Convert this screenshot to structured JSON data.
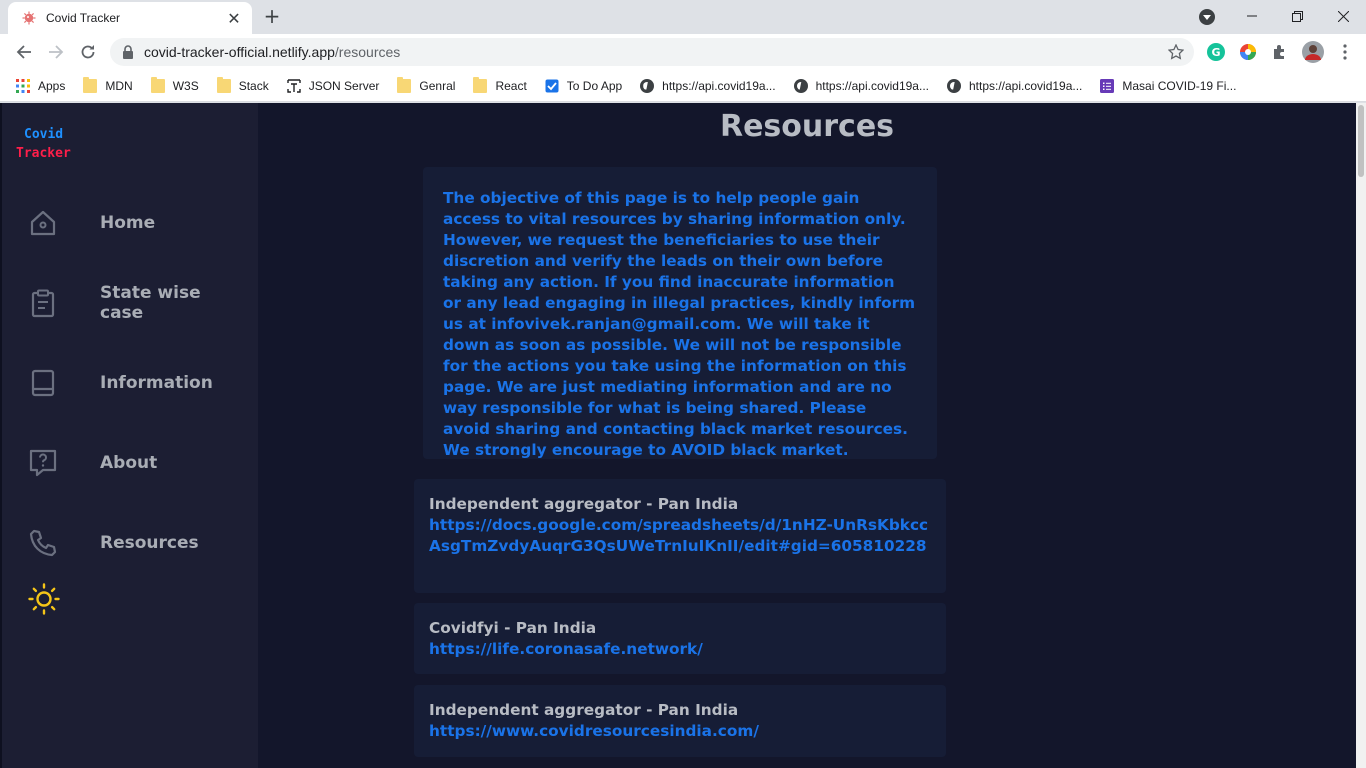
{
  "browser": {
    "tab_title": "Covid Tracker",
    "url_host": "covid-tracker-official.netlify.app",
    "url_path": "/resources",
    "bookmarks": [
      {
        "label": "Apps",
        "icon": "apps-grid-icon"
      },
      {
        "label": "MDN",
        "icon": "folder-icon"
      },
      {
        "label": "W3S",
        "icon": "folder-icon"
      },
      {
        "label": "Stack",
        "icon": "folder-icon"
      },
      {
        "label": "JSON Server",
        "icon": "json-server-icon"
      },
      {
        "label": "Genral",
        "icon": "folder-icon"
      },
      {
        "label": "React",
        "icon": "folder-icon"
      },
      {
        "label": "To Do App",
        "icon": "checkbox-icon"
      },
      {
        "label": "https://api.covid19a...",
        "icon": "globe-icon"
      },
      {
        "label": "https://api.covid19a...",
        "icon": "globe-icon"
      },
      {
        "label": "https://api.covid19a...",
        "icon": "globe-icon"
      },
      {
        "label": "Masai COVID-19 Fi...",
        "icon": "forms-icon"
      }
    ]
  },
  "sidebar": {
    "logo_line1": "Covid",
    "logo_line2": "Tracker",
    "items": [
      {
        "label": "Home",
        "icon": "home-icon"
      },
      {
        "label": "State wise case",
        "icon": "clipboard-icon"
      },
      {
        "label": "Information",
        "icon": "book-icon"
      },
      {
        "label": "About",
        "icon": "help-icon"
      },
      {
        "label": "Resources",
        "icon": "phone-icon"
      }
    ],
    "theme_toggle_icon": "sun-icon"
  },
  "main": {
    "title": "Resources",
    "disclaimer": "The objective of this page is to help people gain access to vital resources by sharing information only. However, we request the beneficiaries to use their discretion and verify the leads on their own before taking any action. If you find inaccurate information or any lead engaging in illegal practices, kindly inform us at infovivek.ranjan@gmail.com. We will take it down as soon as possible. We will not be responsible for the actions you take using the information on this page. We are just mediating information and are no way responsible for what is being shared. Please avoid sharing and contacting black market resources. We strongly encourage to AVOID black market.",
    "resources": [
      {
        "title": "Independent aggregator - Pan India",
        "link": "https://docs.google.com/spreadsheets/d/1nHZ-UnRsKbkccAsgTmZvdyAuqrG3QsUWeTrnIuIKnII/edit#gid=605810228"
      },
      {
        "title": "Covidfyi - Pan India",
        "link": "https://life.coronasafe.network/"
      },
      {
        "title": "Independent aggregator - Pan India",
        "link": "https://www.covidresourcesindia.com/"
      }
    ]
  },
  "colors": {
    "page_bg": "#13162b",
    "sidebar_bg": "#1c1e33",
    "card_bg": "#161d36",
    "accent_blue": "#1a73e8",
    "logo_blue": "#1e90ff",
    "logo_red": "#ff1e4a",
    "sun_yellow": "#f5c518"
  }
}
